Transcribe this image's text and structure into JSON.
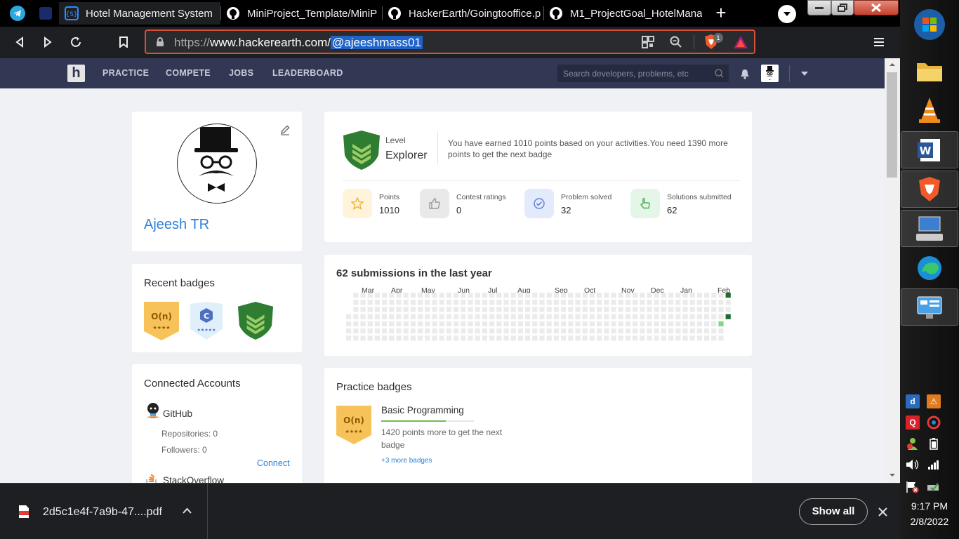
{
  "browser": {
    "tabs": [
      {
        "title": "Hotel Management System"
      },
      {
        "title": "MiniProject_Template/MiniP"
      },
      {
        "title": "HackerEarth/Goingtooffice.p"
      },
      {
        "title": "M1_ProjectGoal_HotelMana"
      }
    ],
    "new_tab_label": "+",
    "url": {
      "protocol": "https://",
      "host": "www.hackerearth.com/",
      "path": "@ajeeshmass01"
    },
    "brave_shield_count": "1"
  },
  "site": {
    "logo": "h",
    "nav": [
      "PRACTICE",
      "COMPETE",
      "JOBS",
      "LEADERBOARD"
    ],
    "search_placeholder": "Search developers, problems, etc"
  },
  "profile": {
    "name": "Ajeesh TR"
  },
  "level": {
    "label": "Level",
    "value": "Explorer",
    "message": "You have earned 1010 points based on your activities.You need 1390 more points to get the next badge"
  },
  "stats": [
    {
      "label": "Points",
      "value": "1010"
    },
    {
      "label": "Contest ratings",
      "value": "0"
    },
    {
      "label": "Problem solved",
      "value": "32"
    },
    {
      "label": "Solutions submitted",
      "value": "62"
    }
  ],
  "recent_badges": {
    "heading": "Recent badges",
    "badges": [
      {
        "name": "O(n)",
        "stars": "★★★★"
      },
      {
        "name": "C",
        "stars": "★★★★★"
      },
      {
        "name": "explorer"
      }
    ]
  },
  "submissions": {
    "heading": "62 submissions in the last year",
    "months": [
      "Mar",
      "Apr",
      "May",
      "Jun",
      "Jul",
      "Aug",
      "Sep",
      "Oct",
      "Nov",
      "Dec",
      "Jan",
      "Feb"
    ]
  },
  "connected_accounts": {
    "heading": "Connected Accounts",
    "github": {
      "name": "GitHub",
      "repos": "Repositories: 0",
      "followers": "Followers: 0",
      "connect": "Connect"
    },
    "stackoverflow": {
      "name": "StackOverflow"
    }
  },
  "practice_badges": {
    "heading": "Practice badges",
    "badge_symbol": "O(n)",
    "badge_stars": "★★★★",
    "title": "Basic Programming",
    "progress": 0.7,
    "subtitle": "1420 points more to get the next badge",
    "more_link": "+3 more badges"
  },
  "download": {
    "filename": "2d5c1e4f-7a9b-47....pdf",
    "show_all": "Show all"
  },
  "taskbar": {
    "time": "9:17 PM",
    "date": "2/8/2022"
  },
  "colors": {
    "accent": "#2f80d8",
    "nav_bg": "#323754",
    "badge_green": "#2e7d32",
    "badge_gold": "#f7c25a"
  }
}
